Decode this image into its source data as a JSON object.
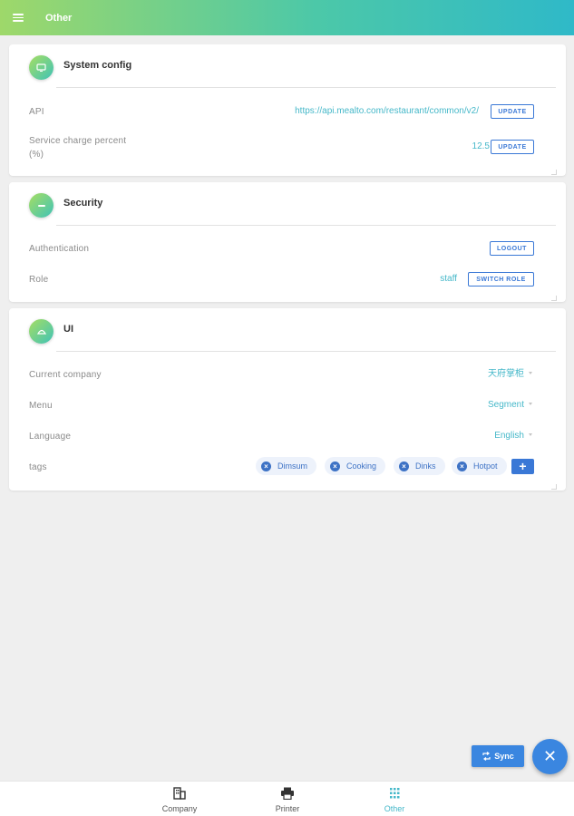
{
  "header": {
    "title": "Other",
    "menu_icon": "hamburger-menu-icon"
  },
  "system_config": {
    "title": "System config",
    "icon": "monitor-icon",
    "api_label": "API",
    "api_value": "https://api.mealto.com/restaurant/common/v2/",
    "api_button": "UPDATE",
    "service_label": "Service charge percent",
    "service_label2": "(%)",
    "service_value": "12.5",
    "service_button": "UPDATE"
  },
  "security": {
    "title": "Security",
    "icon": "minus-circle-icon",
    "auth_label": "Authentication",
    "auth_button": "LOGOUT",
    "role_label": "Role",
    "role_value": "staff",
    "role_button": "SWITCH ROLE"
  },
  "ui": {
    "title": "UI",
    "icon": "palette-icon",
    "company_label": "Current company",
    "company_value": "天府掌柜",
    "menu_label": "Menu",
    "menu_value": "Segment",
    "language_label": "Language",
    "language_value": "English",
    "tags_label": "tags",
    "tags": [
      "Dimsum",
      "Cooking",
      "Dinks",
      "Hotpot"
    ],
    "add_tag": "+"
  },
  "actions": {
    "sync_label": "Sync",
    "fab_icon": "close-icon"
  },
  "bottom_nav": [
    {
      "label": "Company",
      "icon": "building-icon",
      "active": false
    },
    {
      "label": "Printer",
      "icon": "printer-icon",
      "active": false
    },
    {
      "label": "Other",
      "icon": "grid-icon",
      "active": true
    }
  ],
  "colors": {
    "accent": "#46b8c9",
    "primary": "#3a78d6",
    "header_start": "#9ed86a",
    "header_end": "#2fb9c8"
  }
}
